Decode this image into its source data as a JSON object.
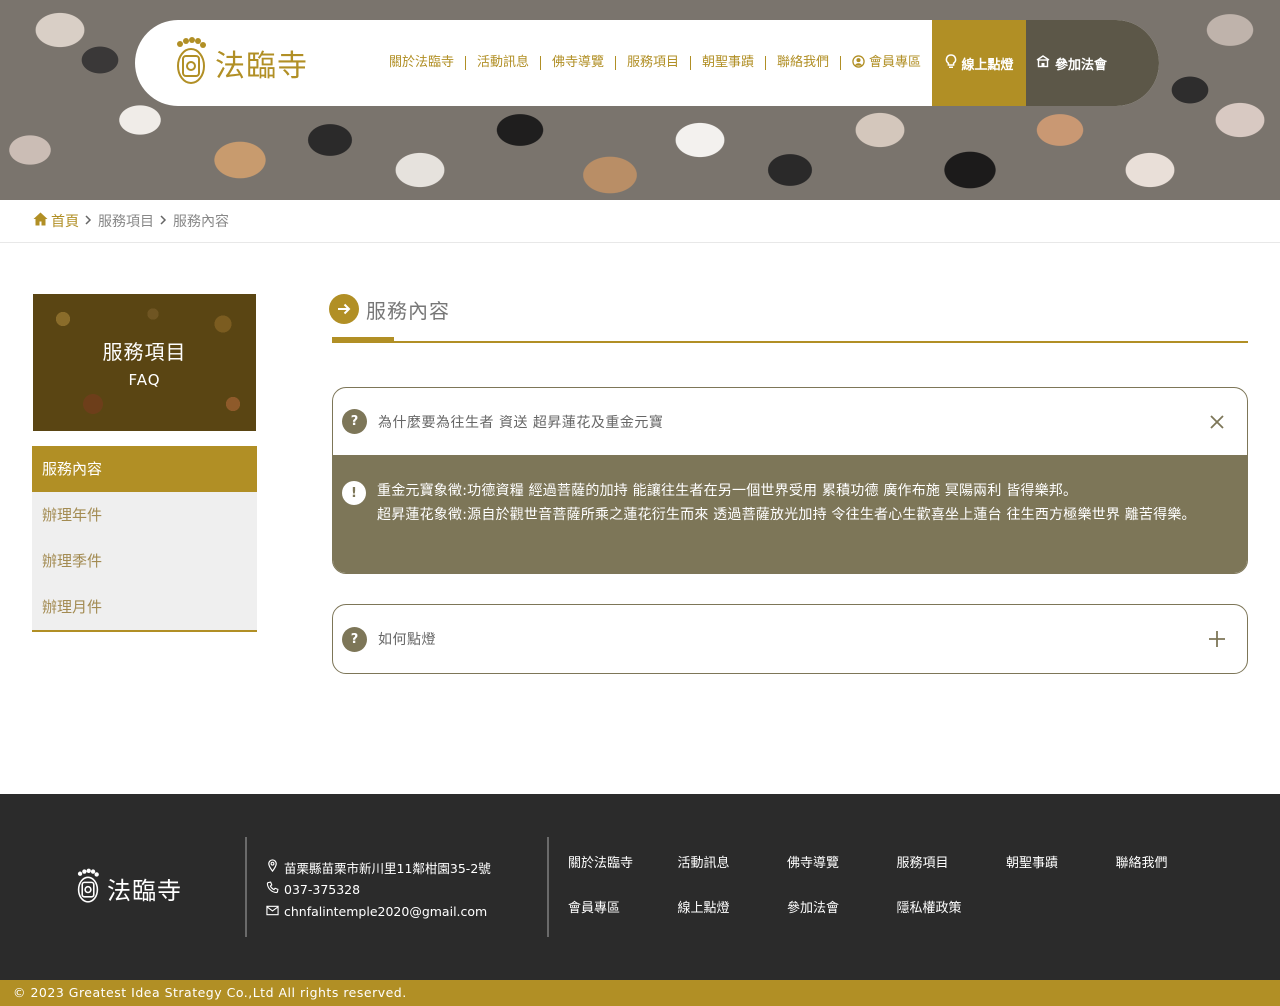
{
  "header": {
    "logo_text": "法臨寺",
    "nav": [
      {
        "label": "關於法臨寺"
      },
      {
        "label": "活動訊息"
      },
      {
        "label": "佛寺導覽"
      },
      {
        "label": "服務項目"
      },
      {
        "label": "朝聖事蹟"
      },
      {
        "label": "聯絡我們"
      },
      {
        "label": "會員專區"
      }
    ],
    "btn_light": "線上點燈",
    "btn_join": "參加法會"
  },
  "breadcrumb": {
    "home": "首頁",
    "level1": "服務項目",
    "level2": "服務內容"
  },
  "sidebar": {
    "banner_title": "服務項目",
    "banner_subtitle": "FAQ",
    "items": [
      {
        "label": "服務內容",
        "active": true
      },
      {
        "label": "辦理年件"
      },
      {
        "label": "辦理季件"
      },
      {
        "label": "辦理月件"
      }
    ]
  },
  "main": {
    "title": "服務內容",
    "faqs": [
      {
        "badge": "?",
        "question": "為什麼要為往生者 資送 超昇蓮花及重金元寶",
        "answer_badge": "!",
        "answer_line1": "重金元寶象徵:功德資糧 經過菩薩的加持 能讓往生者在另一個世界受用 累積功德 廣作布施 冥陽兩利 皆得樂邦。",
        "answer_line2": "超昇蓮花象徵:源自於觀世音菩薩所乘之蓮花衍生而來 透過菩薩放光加持 令往生者心生歡喜坐上蓮台 往生西方極樂世界 離苦得樂。",
        "expanded": true
      },
      {
        "badge": "?",
        "question": "如何點燈",
        "expanded": false
      }
    ]
  },
  "footer": {
    "logo_text": "法臨寺",
    "address": "苗栗縣苗栗市新川里11鄰柑園35-2號",
    "phone": "037-375328",
    "email": "chnfalintemple2020@gmail.com",
    "links": [
      {
        "label": "關於法臨寺"
      },
      {
        "label": "活動訊息"
      },
      {
        "label": "佛寺導覽"
      },
      {
        "label": "服務項目"
      },
      {
        "label": "朝聖事蹟"
      },
      {
        "label": "聯絡我們"
      },
      {
        "label": "會員專區"
      },
      {
        "label": "線上點燈"
      },
      {
        "label": "參加法會"
      },
      {
        "label": "隱私權政策"
      }
    ],
    "copyright": "© 2023 Greatest Idea Strategy Co.,Ltd All rights reserved."
  },
  "colors": {
    "accent": "#b18f25",
    "dark_olive": "#7d7658",
    "nav_dark": "#5c5748",
    "footer_bg": "#2b2b2b"
  },
  "icons": [
    "feet-logo-icon",
    "user-circle-icon",
    "lightbulb-icon",
    "temple-icon",
    "home-icon",
    "chevron-right-icon",
    "arrow-right-circle-icon",
    "close-icon",
    "plus-icon",
    "location-pin-icon",
    "phone-icon",
    "mail-icon"
  ]
}
